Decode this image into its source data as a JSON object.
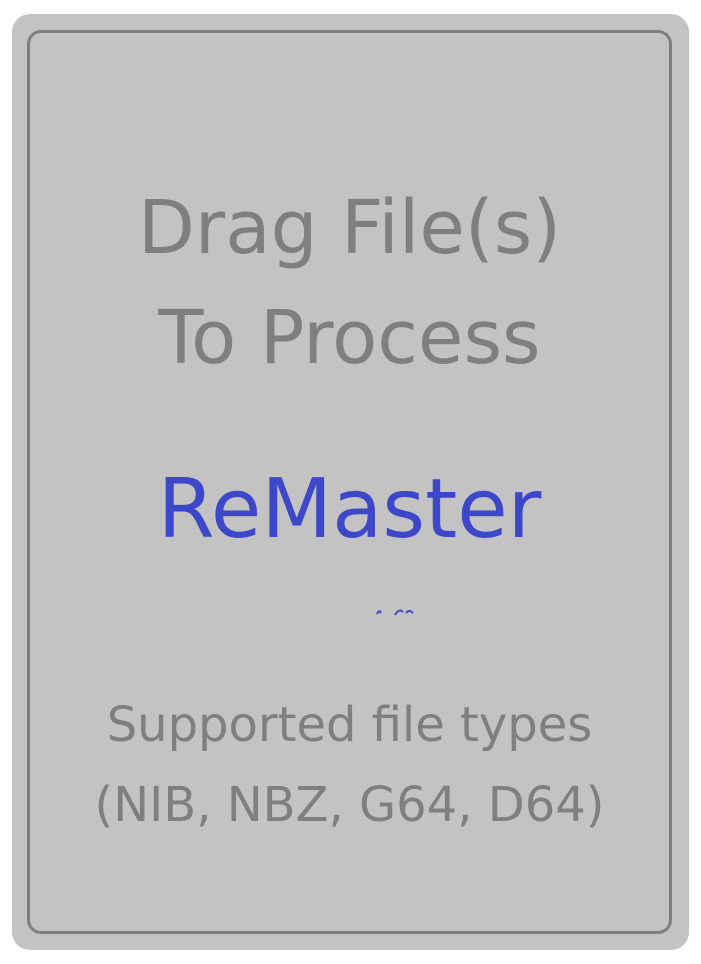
{
  "drop_zone": {
    "line1": "Drag File(s)",
    "line2": "To Process"
  },
  "brand": {
    "name": "ReMaster",
    "color": "#3d47c9"
  },
  "supported": {
    "line1": "Supported file types",
    "line2": "(NIB, NBZ, G64, D64)"
  },
  "colors": {
    "panel_background": "#c3c3c3",
    "text_gray": "#7f7f7f",
    "border_gray": "#7f7f7f"
  }
}
